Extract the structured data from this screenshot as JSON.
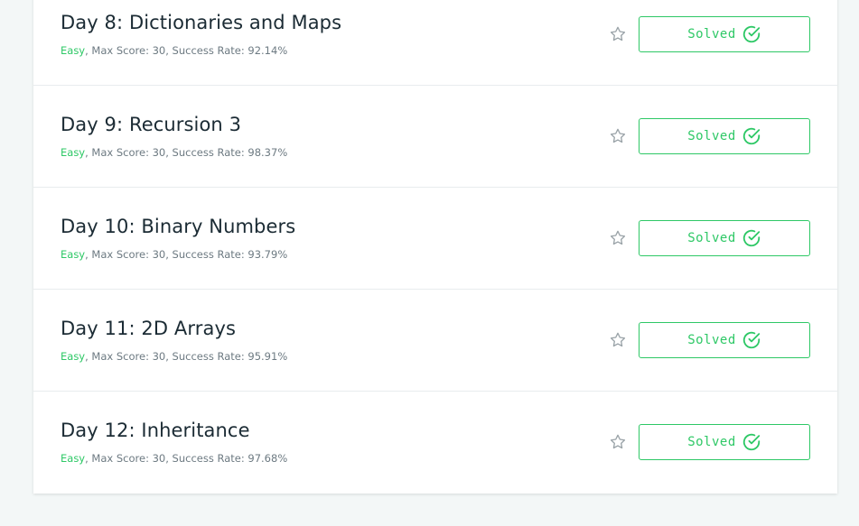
{
  "colors": {
    "accent": "#2ec866",
    "title_text": "#1b2b34",
    "meta_text": "#6d7a82",
    "star": "#9aa3a8",
    "background": "#f3f7f7"
  },
  "rows": [
    {
      "title": "Day 8: Dictionaries and Maps",
      "difficulty": "Easy",
      "meta_rest": ", Max Score: 30, Success Rate: 92.14%",
      "status_label": "Solved",
      "star_icon": "star-outline-icon",
      "status_icon": "check-circle-icon"
    },
    {
      "title": "Day 9: Recursion 3",
      "difficulty": "Easy",
      "meta_rest": ", Max Score: 30, Success Rate: 98.37%",
      "status_label": "Solved",
      "star_icon": "star-outline-icon",
      "status_icon": "check-circle-icon"
    },
    {
      "title": "Day 10: Binary Numbers",
      "difficulty": "Easy",
      "meta_rest": ", Max Score: 30, Success Rate: 93.79%",
      "status_label": "Solved",
      "star_icon": "star-outline-icon",
      "status_icon": "check-circle-icon"
    },
    {
      "title": "Day 11: 2D Arrays",
      "difficulty": "Easy",
      "meta_rest": ", Max Score: 30, Success Rate: 95.91%",
      "status_label": "Solved",
      "star_icon": "star-outline-icon",
      "status_icon": "check-circle-icon"
    },
    {
      "title": "Day 12: Inheritance",
      "difficulty": "Easy",
      "meta_rest": ", Max Score: 30, Success Rate: 97.68%",
      "status_label": "Solved",
      "star_icon": "star-outline-icon",
      "status_icon": "check-circle-icon"
    }
  ]
}
